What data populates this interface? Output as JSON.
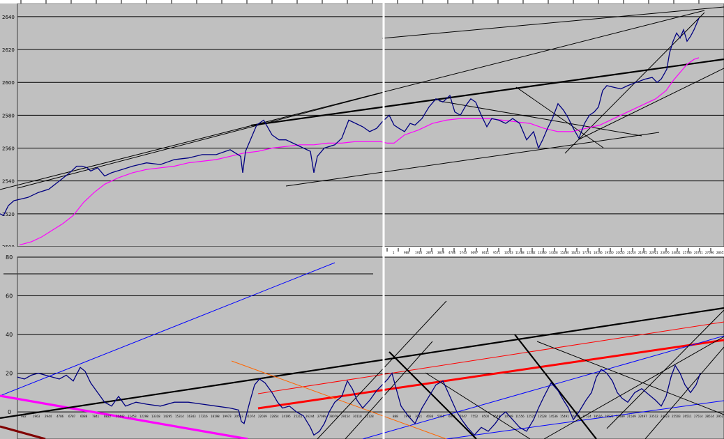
{
  "colors": {
    "background": "#c0c0c0",
    "grid": "#000000",
    "price": "#000080",
    "average": "#ff00ff",
    "divider": "#ffffff",
    "trend_black": "#000000",
    "trend_red": "#ff0000",
    "trend_blue": "#0000ff",
    "trend_orange": "#ff6600",
    "trend_magenta": "#ff00ff",
    "trend_darkred": "#800000"
  },
  "chart_data": [
    {
      "type": "line",
      "panel": "top",
      "y_ticks": [
        "2500",
        "2520",
        "2540",
        "2560",
        "2580",
        "2600",
        "2620",
        "2640"
      ],
      "ylim": [
        2500,
        2648
      ],
      "x_tick_labels": [
        "1",
        "988",
        "1916",
        "2873",
        "3839",
        "4786",
        "5743",
        "6697",
        "8611",
        "9571",
        "10503",
        "11488",
        "12382",
        "13360",
        "14328",
        "15280",
        "16233",
        "17191",
        "18146",
        "19100",
        "20055",
        "21010",
        "21965",
        "22921",
        "23876",
        "24831",
        "25786",
        "26741",
        "27696",
        "28651"
      ],
      "grid": true,
      "series": [
        {
          "role": "price",
          "x": [
            0,
            5,
            12,
            20,
            30,
            40,
            55,
            70,
            85,
            100,
            110,
            118,
            125,
            130,
            140,
            150,
            160,
            175,
            190,
            210,
            230,
            250,
            270,
            290,
            310,
            330,
            345,
            348,
            352,
            360,
            368,
            378,
            390,
            400,
            410,
            420,
            435,
            445,
            450,
            455,
            465,
            480,
            490,
            500,
            510,
            520,
            530,
            540,
            548,
            558,
            565,
            572,
            580,
            588,
            595,
            605,
            615,
            625,
            635,
            645,
            652,
            660,
            668,
            675,
            682,
            690,
            698,
            705,
            715,
            725,
            735,
            745,
            755,
            765,
            772,
            778,
            785,
            792,
            800,
            808,
            815,
            822,
            830,
            838,
            845,
            852,
            858,
            864,
            870,
            880,
            890,
            900,
            912,
            925,
            935,
            942,
            948,
            952,
            956,
            960,
            965,
            970,
            975,
            980,
            985,
            990,
            995,
            1000,
            1002
          ],
          "y": [
            2520,
            2519,
            2525,
            2528,
            2529,
            2530,
            2533,
            2535,
            2540,
            2545,
            2549,
            2549,
            2548,
            2546,
            2548,
            2543,
            2545,
            2547,
            2549,
            2551,
            2550,
            2553,
            2554,
            2556,
            2556,
            2559,
            2555,
            2545,
            2558,
            2566,
            2574,
            2577,
            2568,
            2565,
            2565,
            2563,
            2560,
            2558,
            2545,
            2555,
            2560,
            2562,
            2566,
            2577,
            2575,
            2573,
            2570,
            2572,
            2576,
            2580,
            2574,
            2572,
            2570,
            2575,
            2574,
            2578,
            2585,
            2590,
            2588,
            2592,
            2582,
            2580,
            2586,
            2590,
            2588,
            2580,
            2573,
            2578,
            2577,
            2575,
            2578,
            2575,
            2565,
            2570,
            2560,
            2565,
            2572,
            2578,
            2587,
            2583,
            2578,
            2572,
            2566,
            2575,
            2580,
            2582,
            2585,
            2595,
            2598,
            2597,
            2596,
            2598,
            2600,
            2602,
            2603,
            2600,
            2602,
            2605,
            2608,
            2618,
            2625,
            2630,
            2627,
            2632,
            2625,
            2628,
            2632,
            2637,
            2639
          ]
        },
        {
          "role": "average",
          "x": [
            28,
            45,
            60,
            75,
            90,
            105,
            120,
            135,
            150,
            170,
            190,
            210,
            230,
            250,
            270,
            290,
            310,
            330,
            350,
            370,
            390,
            410,
            430,
            450,
            470,
            490,
            510,
            530,
            545,
            555,
            565,
            580,
            600,
            620,
            640,
            660,
            680,
            700,
            720,
            740,
            760,
            780,
            800,
            820,
            840,
            860,
            880,
            900,
            920,
            940,
            955,
            965,
            975,
            985,
            995,
            1002
          ],
          "y": [
            2501,
            2503,
            2506,
            2510,
            2514,
            2519,
            2527,
            2533,
            2538,
            2542,
            2545,
            2547,
            2548,
            2549,
            2551,
            2552,
            2553,
            2555,
            2557,
            2558,
            2560,
            2561,
            2562,
            2562,
            2563,
            2563,
            2564,
            2564,
            2564,
            2563,
            2563,
            2568,
            2571,
            2575,
            2577,
            2578,
            2578,
            2578,
            2577,
            2576,
            2575,
            2572,
            2570,
            2570,
            2572,
            2574,
            2578,
            2582,
            2586,
            2590,
            2595,
            2601,
            2606,
            2611,
            2614,
            2615
          ]
        }
      ]
    },
    {
      "type": "line",
      "panel": "bottom",
      "y_ticks": [
        "0",
        "20",
        "40",
        "60",
        "80"
      ],
      "ylim": [
        -14,
        80
      ],
      "x_tick_labels": [
        "982",
        "1963",
        "2944",
        "4786",
        "6787",
        "6088",
        "7841",
        "8822",
        "10442",
        "11453",
        "12298",
        "13318",
        "14295",
        "15314",
        "16343",
        "17216",
        "18198",
        "19973",
        "20523",
        "21074",
        "22039",
        "22854",
        "24195",
        "25211",
        "26244",
        "27089",
        "28079",
        "29154",
        "30118",
        "31128",
        "888",
        "1979",
        "3021",
        "4036",
        "5050",
        "6091",
        "7047",
        "7552",
        "8500",
        "9548",
        "10549",
        "11556",
        "12525",
        "13528",
        "14536",
        "15491",
        "16513",
        "17524",
        "18516",
        "19521",
        "20489",
        "21509",
        "22497",
        "23512",
        "24523",
        "25503",
        "26511",
        "27514",
        "28514",
        "29521"
      ],
      "grid": true,
      "series": [
        {
          "role": "oscillator",
          "x": [
            25,
            35,
            45,
            55,
            65,
            75,
            85,
            95,
            105,
            115,
            122,
            130,
            140,
            150,
            160,
            170,
            180,
            195,
            210,
            230,
            250,
            270,
            290,
            310,
            330,
            342,
            346,
            350,
            358,
            365,
            372,
            380,
            390,
            398,
            405,
            415,
            425,
            435,
            445,
            450,
            458,
            465,
            472,
            480,
            490,
            498,
            505,
            512,
            520,
            530,
            540,
            548,
            556,
            562,
            568,
            575,
            585,
            595,
            605,
            615,
            625,
            635,
            645,
            655,
            662,
            670,
            680,
            690,
            700,
            710,
            718,
            725,
            735,
            745,
            755,
            765,
            772,
            780,
            790,
            800,
            808,
            815,
            822,
            830,
            840,
            848,
            855,
            862,
            870,
            878,
            885,
            892,
            900,
            910,
            920,
            930,
            940,
            948,
            955,
            962,
            968,
            975,
            982,
            990,
            998,
            1004
          ],
          "y": [
            18,
            17,
            19,
            20,
            19,
            18,
            17,
            19,
            16,
            23,
            21,
            15,
            10,
            5,
            3,
            8,
            3,
            5,
            4,
            3,
            5,
            5,
            4,
            3,
            2,
            1,
            -5,
            -6,
            5,
            14,
            17,
            15,
            10,
            5,
            2,
            3,
            0,
            -2,
            -8,
            -12,
            -10,
            -6,
            0,
            5,
            8,
            16,
            12,
            6,
            2,
            6,
            11,
            14,
            17,
            20,
            12,
            3,
            -2,
            -6,
            2,
            8,
            14,
            16,
            8,
            0,
            -4,
            -8,
            -12,
            -8,
            -10,
            -6,
            -2,
            0,
            -4,
            -8,
            -10,
            -4,
            2,
            8,
            15,
            11,
            6,
            2,
            -4,
            0,
            6,
            10,
            18,
            22,
            20,
            16,
            10,
            7,
            5,
            10,
            12,
            9,
            6,
            3,
            8,
            18,
            24,
            20,
            14,
            10,
            14,
            20
          ]
        }
      ]
    }
  ]
}
